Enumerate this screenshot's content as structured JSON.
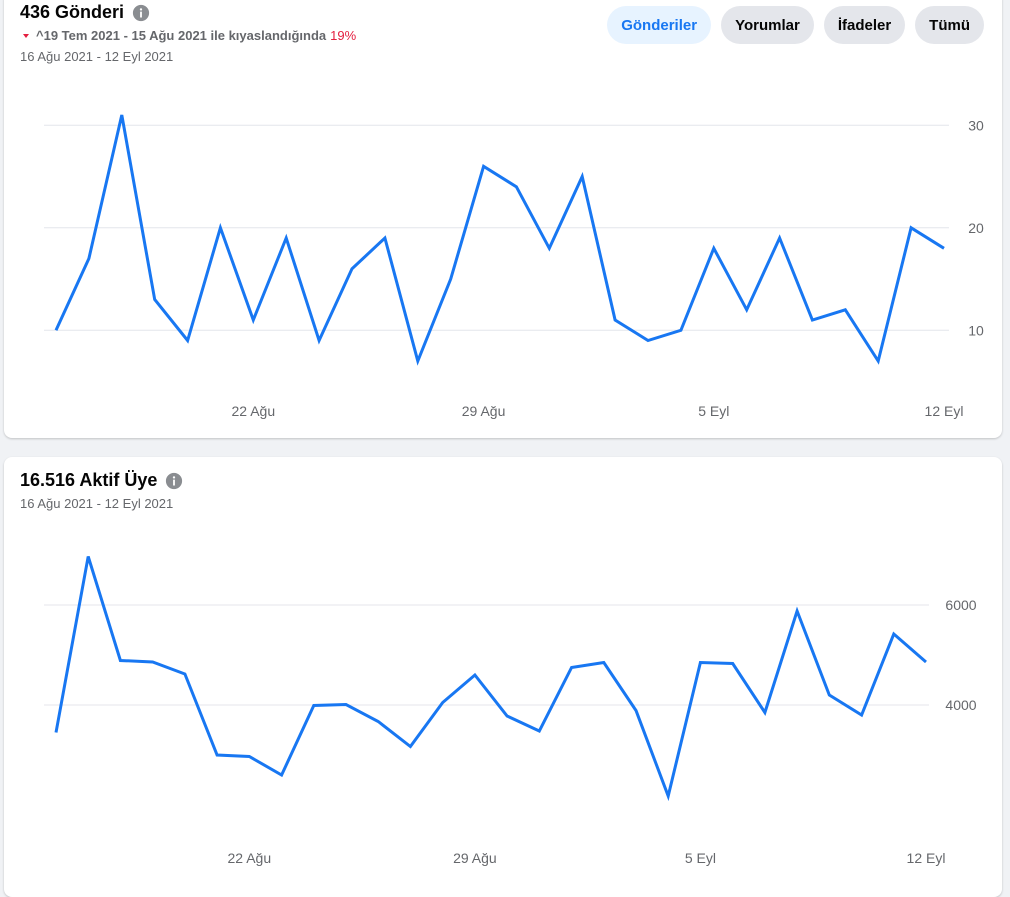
{
  "posts": {
    "title": "436 Gönderi",
    "comparison_text": "^19 Tem 2021 - 15 Ağu 2021 ile kıyaslandığında",
    "comparison_pct": "19%",
    "date_range": "16 Ağu 2021 - 12 Eyl 2021",
    "tabs": [
      {
        "label": "Gönderiler",
        "active": true
      },
      {
        "label": "Yorumlar",
        "active": false
      },
      {
        "label": "İfadeler",
        "active": false
      },
      {
        "label": "Tümü",
        "active": false
      }
    ]
  },
  "members": {
    "title": "16.516 Aktif Üye",
    "date_range": "16 Ağu 2021 - 12 Eyl 2021"
  },
  "colors": {
    "line": "#1877f2",
    "negative": "#e41e3f",
    "accent": "#1877f2"
  },
  "chart_data": [
    {
      "type": "line",
      "x": [
        "16 Ağu",
        "17 Ağu",
        "18 Ağu",
        "19 Ağu",
        "20 Ağu",
        "21 Ağu",
        "22 Ağu",
        "23 Ağu",
        "24 Ağu",
        "25 Ağu",
        "26 Ağu",
        "27 Ağu",
        "28 Ağu",
        "29 Ağu",
        "30 Ağu",
        "31 Ağu",
        "1 Eyl",
        "2 Eyl",
        "3 Eyl",
        "4 Eyl",
        "5 Eyl",
        "6 Eyl",
        "7 Eyl",
        "8 Eyl",
        "9 Eyl",
        "10 Eyl",
        "11 Eyl",
        "12 Eyl"
      ],
      "values": [
        10,
        17,
        31,
        13,
        9,
        20,
        11,
        19,
        9,
        16,
        19,
        7,
        15,
        26,
        24,
        18,
        25,
        11,
        9,
        10,
        18,
        12,
        19,
        11,
        12,
        7,
        20,
        18
      ],
      "xticks": [
        "22 Ağu",
        "29 Ağu",
        "5 Eyl",
        "12 Eyl"
      ],
      "yticks": [
        10,
        20,
        30
      ],
      "ylim": [
        3,
        35
      ],
      "grid": true,
      "title": "",
      "xlabel": "",
      "ylabel": ""
    },
    {
      "type": "line",
      "x": [
        "16 Ağu",
        "17 Ağu",
        "18 Ağu",
        "19 Ağu",
        "20 Ağu",
        "21 Ağu",
        "22 Ağu",
        "23 Ağu",
        "24 Ağu",
        "25 Ağu",
        "26 Ağu",
        "27 Ağu",
        "28 Ağu",
        "29 Ağu",
        "30 Ağu",
        "31 Ağu",
        "1 Eyl",
        "2 Eyl",
        "3 Eyl",
        "4 Eyl",
        "5 Eyl",
        "6 Eyl",
        "7 Eyl",
        "8 Eyl",
        "9 Eyl",
        "10 Eyl",
        "11 Eyl",
        "12 Eyl"
      ],
      "values": [
        3450,
        6970,
        4890,
        4860,
        4620,
        3000,
        2970,
        2600,
        3990,
        4010,
        3670,
        3170,
        4050,
        4600,
        3780,
        3480,
        4750,
        4850,
        3890,
        2180,
        4850,
        4830,
        3850,
        5880,
        4200,
        3800,
        5420,
        4860
      ],
      "xticks": [
        "22 Ağu",
        "29 Ağu",
        "5 Eyl",
        "12 Eyl"
      ],
      "yticks": [
        4000,
        6000
      ],
      "ylim": [
        1200,
        7600
      ],
      "grid": true,
      "title": "",
      "xlabel": "",
      "ylabel": ""
    }
  ]
}
